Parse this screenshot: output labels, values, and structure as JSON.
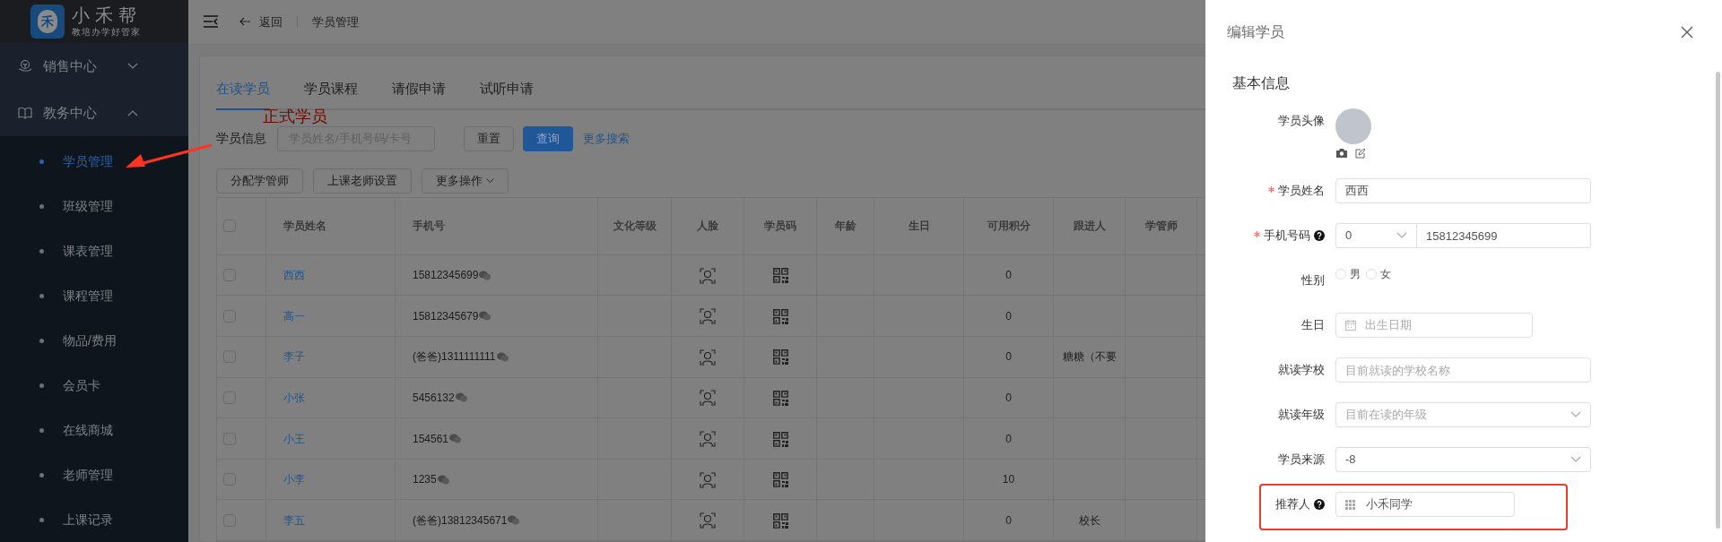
{
  "sidebar": {
    "logo": {
      "mark": "禾",
      "name": "小禾帮",
      "slogan": "教培办学好管家"
    },
    "groups": [
      {
        "label": "销售中心",
        "expanded": false
      },
      {
        "label": "教务中心",
        "expanded": true,
        "children": [
          {
            "label": "学员管理",
            "selected": true
          },
          {
            "label": "班级管理",
            "selected": false
          },
          {
            "label": "课表管理",
            "selected": false
          },
          {
            "label": "课程管理",
            "selected": false
          },
          {
            "label": "物品/费用",
            "selected": false
          },
          {
            "label": "会员卡",
            "selected": false
          },
          {
            "label": "在线商城",
            "selected": false
          },
          {
            "label": "老师管理",
            "selected": false
          },
          {
            "label": "上课记录",
            "selected": false
          }
        ]
      }
    ]
  },
  "annotation": {
    "label": "正式学员"
  },
  "topbar": {
    "back": "返回",
    "breadcrumb": "学员管理"
  },
  "tabs": [
    {
      "label": "在读学员",
      "selected": true
    },
    {
      "label": "学员课程",
      "selected": false
    },
    {
      "label": "请假申请",
      "selected": false
    },
    {
      "label": "试听申请",
      "selected": false
    }
  ],
  "search": {
    "label": "学员信息",
    "placeholder": "学员姓名/手机号码/卡号",
    "buttons": [
      {
        "label": "重置",
        "primary": false
      },
      {
        "label": "查询",
        "primary": true
      }
    ],
    "more_link": "更多搜索"
  },
  "actions": [
    {
      "label": "分配学管师",
      "dropdown": false
    },
    {
      "label": "上课老师设置",
      "dropdown": false
    },
    {
      "label": "更多操作",
      "dropdown": true
    }
  ],
  "table": {
    "all_checked": false,
    "columns": [
      "学员姓名",
      "手机号",
      "文化等级",
      "人脸",
      "学员码",
      "年龄",
      "生日",
      "可用积分",
      "跟进人",
      "学管师"
    ],
    "rows": [
      {
        "checked": false,
        "name": "西西",
        "phone": "15812345699",
        "points": "0"
      },
      {
        "checked": false,
        "name": "高一",
        "phone": "15812345679",
        "points": "0"
      },
      {
        "checked": false,
        "name": "李子",
        "phone": "(爸爸)1311111111",
        "points": "0",
        "follower": "糖糖（不要"
      },
      {
        "checked": false,
        "name": "小张",
        "phone": "5456132",
        "points": "0"
      },
      {
        "checked": false,
        "name": "小王",
        "phone": "154561",
        "points": "0"
      },
      {
        "checked": false,
        "name": "小李",
        "phone": "1235",
        "points": "10"
      },
      {
        "checked": false,
        "name": "李五",
        "phone": "(爸爸)13812345671",
        "points": "0",
        "follower": "校长"
      }
    ]
  },
  "drawer": {
    "title": "编辑学员",
    "section": "基本信息",
    "fields": [
      {
        "kind": "avatar",
        "label": "学员头像",
        "required": false,
        "help": false,
        "highlighted": false
      },
      {
        "kind": "text",
        "label": "学员姓名",
        "required": true,
        "help": false,
        "highlighted": false,
        "value": "西西"
      },
      {
        "kind": "phone",
        "label": "手机号码",
        "required": true,
        "help": true,
        "highlighted": false,
        "code": "0",
        "value": "15812345699"
      },
      {
        "kind": "radio",
        "label": "性别",
        "required": false,
        "help": false,
        "highlighted": false,
        "options": [
          {
            "label": "男",
            "selected": false
          },
          {
            "label": "女",
            "selected": false
          }
        ]
      },
      {
        "kind": "date",
        "label": "生日",
        "required": false,
        "help": false,
        "highlighted": false,
        "placeholder": "出生日期"
      },
      {
        "kind": "text",
        "label": "就读学校",
        "required": false,
        "help": false,
        "highlighted": false,
        "placeholder": "目前就读的学校名称"
      },
      {
        "kind": "select",
        "label": "就读年级",
        "required": false,
        "help": false,
        "highlighted": false,
        "placeholder": "目前在读的年级"
      },
      {
        "kind": "select",
        "label": "学员来源",
        "required": false,
        "help": false,
        "highlighted": false,
        "value": "-8"
      },
      {
        "kind": "referrer",
        "label": "推荐人",
        "required": false,
        "help": true,
        "highlighted": true,
        "value": "小禾同学"
      }
    ]
  }
}
